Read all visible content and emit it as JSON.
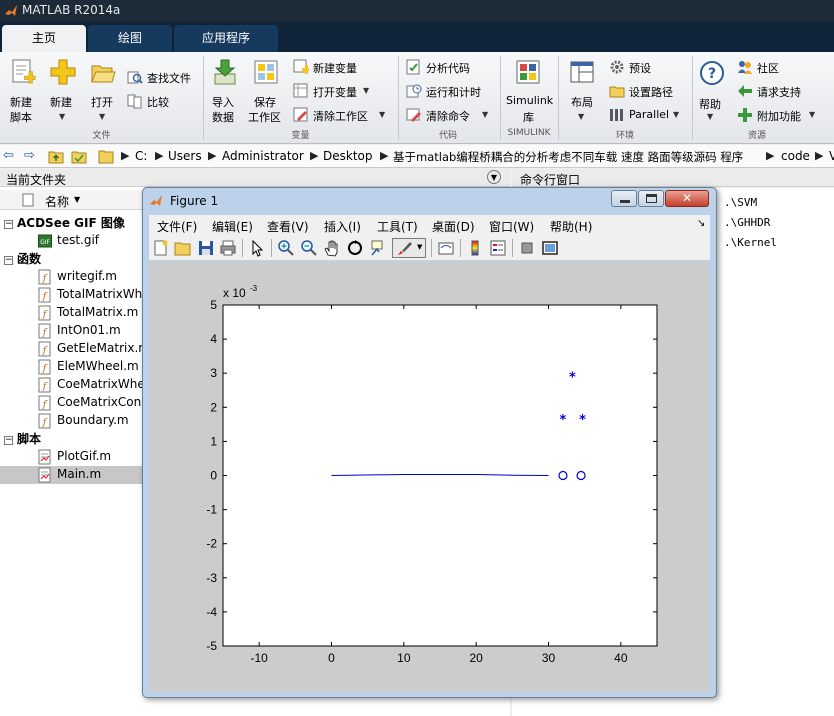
{
  "app": {
    "title": "MATLAB R2014a"
  },
  "tabs": [
    {
      "label": "主页",
      "active": true
    },
    {
      "label": "绘图",
      "active": false
    },
    {
      "label": "应用程序",
      "active": false
    }
  ],
  "ribbon": {
    "new_script": [
      "新建",
      "脚本"
    ],
    "new": "新建",
    "open": "打开",
    "find_files": "查找文件",
    "compare": "比较",
    "import": [
      "导入",
      "数据"
    ],
    "save_ws": [
      "保存",
      "工作区"
    ],
    "new_var": "新建变量",
    "open_var": "打开变量",
    "clear_ws": "清除工作区",
    "analyze": "分析代码",
    "run_time": "运行和计时",
    "clear_cmd": "清除命令",
    "simulink": [
      "Simulink",
      "库"
    ],
    "layout": "布局",
    "prefs": "预设",
    "set_path": "设置路径",
    "parallel": "Parallel",
    "help": "帮助",
    "community": "社区",
    "support": "请求支持",
    "addons": "附加功能",
    "groups": {
      "file": "文件",
      "variable": "变量",
      "code": "代码",
      "simulink": "SIMULINK",
      "env": "环境",
      "resources": "资源"
    }
  },
  "address": [
    "C:",
    "Users",
    "Administrator",
    "Desktop",
    "基于matlab编程桥耦合的分析考虑不同车载 速度 路面等级源码 程序",
    "code",
    "V"
  ],
  "current_folder": {
    "title": "当前文件夹",
    "name_col": "名称",
    "groups": [
      {
        "label": "ACDSee GIF 图像",
        "files": [
          {
            "name": "test.gif",
            "type": "gif"
          }
        ]
      },
      {
        "label": "函数",
        "files": [
          {
            "name": "writegif.m",
            "type": "fn"
          },
          {
            "name": "TotalMatrixWhe",
            "type": "fn"
          },
          {
            "name": "TotalMatrix.m",
            "type": "fn"
          },
          {
            "name": "IntOn01.m",
            "type": "fn"
          },
          {
            "name": "GetEleMatrix.m",
            "type": "fn"
          },
          {
            "name": "EleMWheel.m",
            "type": "fn"
          },
          {
            "name": "CoeMatrixWhe",
            "type": "fn"
          },
          {
            "name": "CoeMatrixCon",
            "type": "fn"
          },
          {
            "name": "Boundary.m",
            "type": "fn"
          }
        ]
      },
      {
        "label": "脚本",
        "files": [
          {
            "name": "PlotGif.m",
            "type": "script"
          },
          {
            "name": "Main.m",
            "type": "script",
            "selected": true
          }
        ]
      }
    ]
  },
  "command_window": {
    "title": "命令行窗口",
    "lines": [
      ".\\SVM",
      ".\\GHHDR",
      ".\\Kernel"
    ]
  },
  "figure": {
    "title": "Figure 1",
    "menu": [
      "文件(F)",
      "编辑(E)",
      "查看(V)",
      "插入(I)",
      "工具(T)",
      "桌面(D)",
      "窗口(W)",
      "帮助(H)"
    ]
  },
  "chart_data": {
    "type": "line",
    "title": "",
    "xlabel": "",
    "ylabel": "",
    "xlim": [
      -15,
      45
    ],
    "ylim": [
      -5,
      5
    ],
    "x_ticks": [
      -10,
      0,
      10,
      20,
      30,
      40
    ],
    "y_ticks": [
      -5,
      -4,
      -3,
      -2,
      -1,
      0,
      1,
      2,
      3,
      4,
      5
    ],
    "y_exponent": "x 10",
    "y_exponent_power": "-3",
    "grid": false,
    "line": {
      "color": "#0000cc",
      "x": [
        0,
        10,
        20,
        25,
        30
      ],
      "y": [
        0,
        0.03,
        0.03,
        0.01,
        0
      ]
    },
    "circles": {
      "color": "#0000cc",
      "x": [
        32,
        34.5
      ],
      "y": [
        0,
        0
      ]
    },
    "stars": {
      "color": "#0000cc",
      "x": [
        32,
        33.3,
        34.7
      ],
      "y": [
        1.65,
        2.9,
        1.65
      ]
    }
  }
}
